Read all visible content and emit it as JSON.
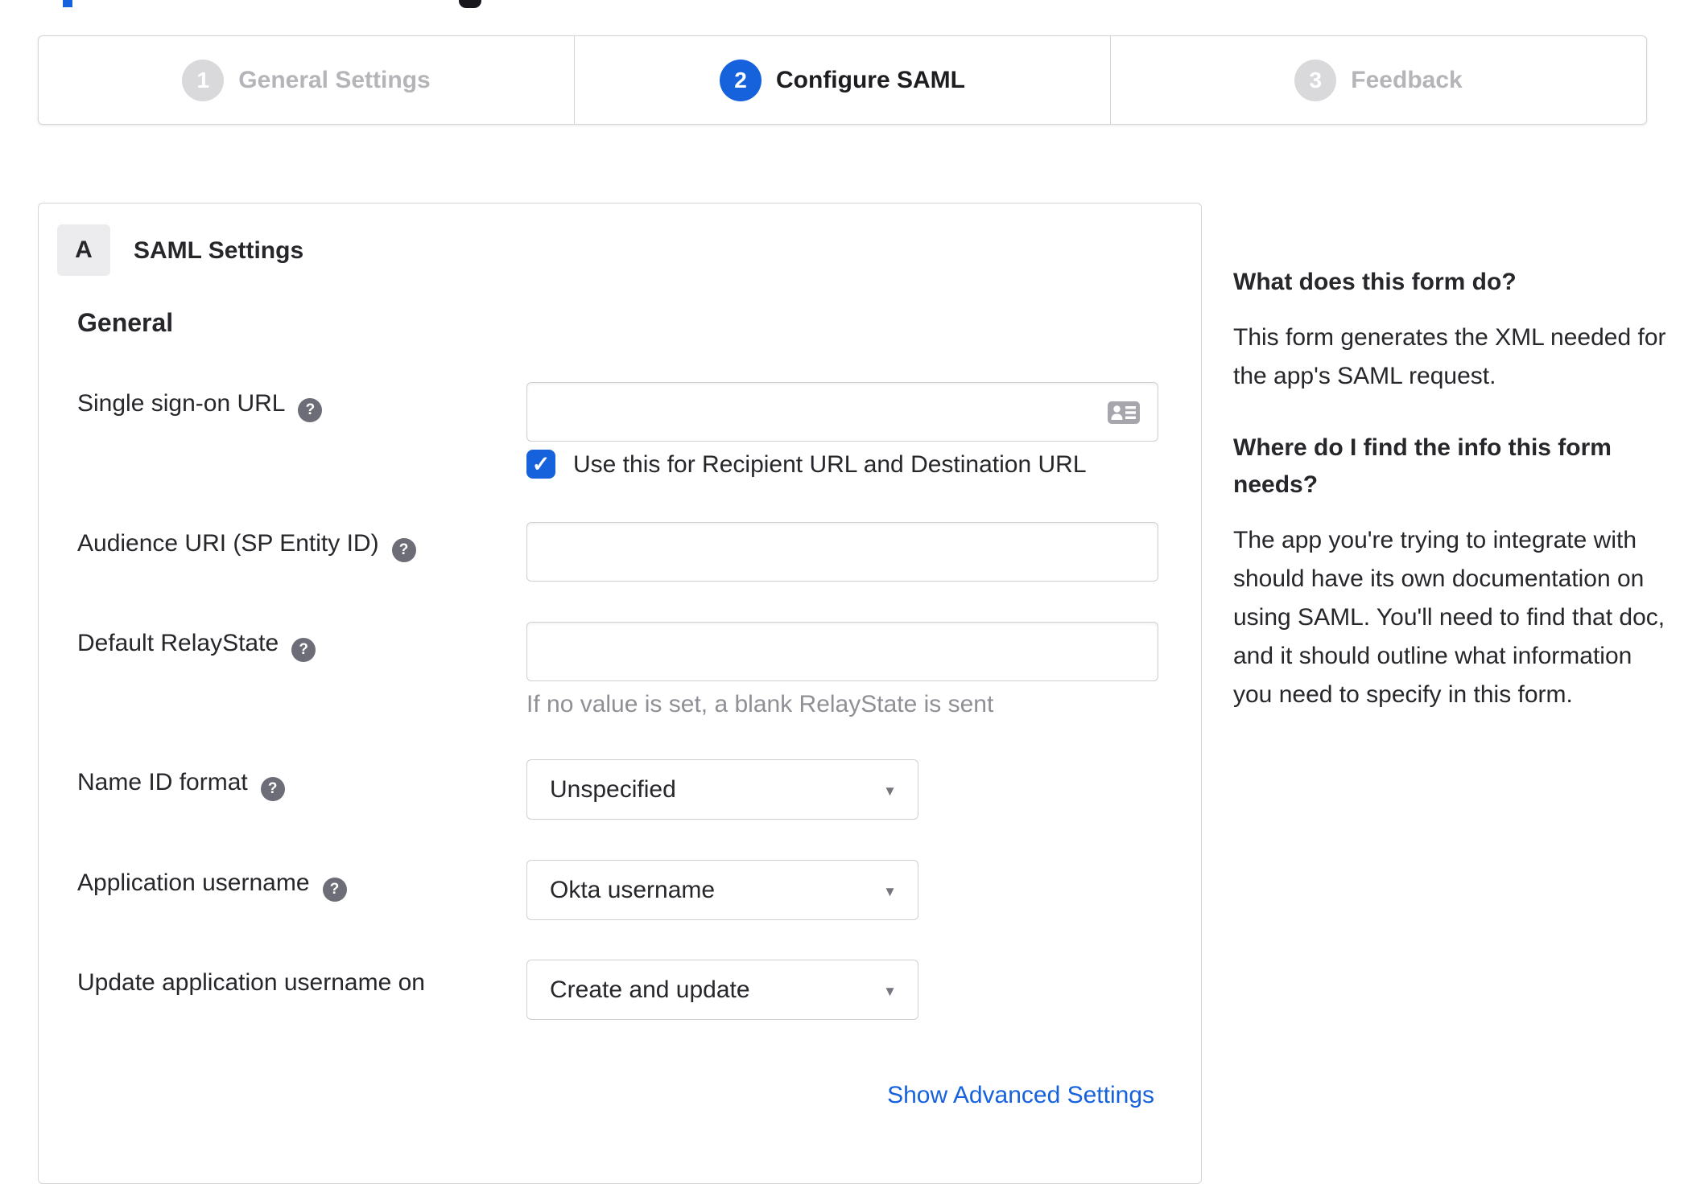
{
  "icons": {
    "help": "?",
    "caret": "▼",
    "check": "✓"
  },
  "colors": {
    "accent_blue": "#1662dd",
    "inactive_grey": "#d9d9dc",
    "border_grey": "#d5d5d9",
    "text": "#26262b",
    "muted_grey": "#8f8f96",
    "link_blue": "#1662dd"
  },
  "stepper": {
    "steps": [
      {
        "number": "1",
        "label": "General Settings",
        "state": "inactive"
      },
      {
        "number": "2",
        "label": "Configure SAML",
        "state": "active"
      },
      {
        "number": "3",
        "label": "Feedback",
        "state": "inactive"
      }
    ]
  },
  "panel": {
    "badge": "A",
    "title": "SAML Settings",
    "section": "General",
    "fields": {
      "sso": {
        "label": "Single sign-on URL",
        "value": "",
        "checkbox_label": "Use this for Recipient URL and Destination URL",
        "checked": true
      },
      "audience": {
        "label": "Audience URI (SP Entity ID)",
        "value": ""
      },
      "relay": {
        "label": "Default RelayState",
        "value": "",
        "hint": "If no value is set, a blank RelayState is sent"
      },
      "name_id": {
        "label": "Name ID format",
        "value": "Unspecified"
      },
      "app_username": {
        "label": "Application username",
        "value": "Okta username"
      },
      "update_username": {
        "label": "Update application username on",
        "value": "Create and update"
      }
    },
    "advanced_link": "Show Advanced Settings"
  },
  "sidebar": {
    "q1": "What does this form do?",
    "a1": "This form generates the XML needed for the app's SAML request.",
    "q2": "Where do I find the info this form needs?",
    "a2": "The app you're trying to integrate with should have its own documentation on using SAML. You'll need to find that doc, and it should outline what information you need to specify in this form."
  }
}
